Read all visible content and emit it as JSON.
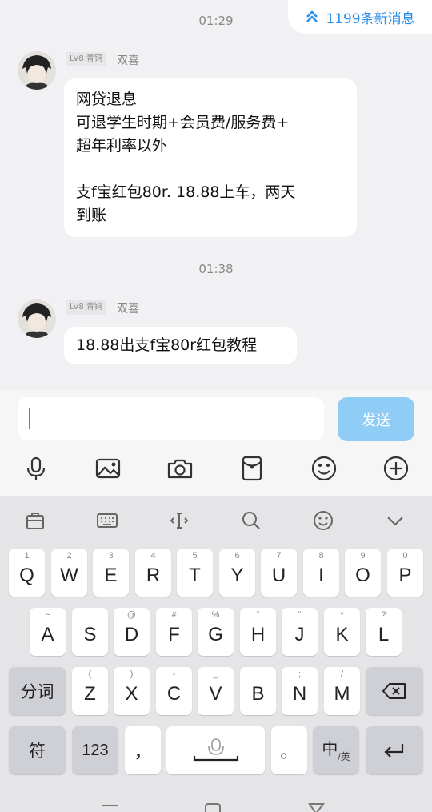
{
  "chat": {
    "new_messages": "1199条新消息",
    "messages": [
      {
        "time": "01:29",
        "level": "LV8 青铜",
        "nickname": "双喜",
        "text": "网贷退息\n可退学生时期+会员费/服务费+\n超年利率以外\n\n支f宝红包80r. 18.88上车，两天\n到账"
      },
      {
        "time": "01:38",
        "level": "LV8 青铜",
        "nickname": "双喜",
        "text": "18.88出支f宝80r红包教程"
      }
    ]
  },
  "input": {
    "value": "",
    "send_label": "发送"
  },
  "tools": [
    "mic-icon",
    "image-icon",
    "camera-icon",
    "red-packet-icon",
    "emoji-icon",
    "plus-icon"
  ],
  "keyboard": {
    "toolbar": [
      "clipboard-icon",
      "keyboard-icon",
      "cursor-icon",
      "search-icon",
      "emoji-icon",
      "collapse-icon"
    ],
    "row1": [
      {
        "num": "1",
        "key": "Q"
      },
      {
        "num": "2",
        "key": "W"
      },
      {
        "num": "3",
        "key": "E"
      },
      {
        "num": "4",
        "key": "R"
      },
      {
        "num": "5",
        "key": "T"
      },
      {
        "num": "6",
        "key": "Y"
      },
      {
        "num": "7",
        "key": "U"
      },
      {
        "num": "8",
        "key": "I"
      },
      {
        "num": "9",
        "key": "O"
      },
      {
        "num": "0",
        "key": "P"
      }
    ],
    "row2": [
      {
        "num": "~",
        "key": "A"
      },
      {
        "num": "!",
        "key": "S"
      },
      {
        "num": "@",
        "key": "D"
      },
      {
        "num": "#",
        "key": "F"
      },
      {
        "num": "%",
        "key": "G"
      },
      {
        "num": "“",
        "key": "H"
      },
      {
        "num": "”",
        "key": "J"
      },
      {
        "num": "*",
        "key": "K"
      },
      {
        "num": "?",
        "key": "L"
      }
    ],
    "row3": [
      {
        "num": "(",
        "key": "Z"
      },
      {
        "num": ")",
        "key": "X"
      },
      {
        "num": "-",
        "key": "C"
      },
      {
        "num": "_",
        "key": "V"
      },
      {
        "num": ":",
        "key": "B"
      },
      {
        "num": ";",
        "key": "N"
      },
      {
        "num": "/",
        "key": "M"
      }
    ],
    "fenci": "分词",
    "fu": "符",
    "num123": "123",
    "comma": "，",
    "period": "。",
    "zhong": "中",
    "ying": "/英"
  }
}
